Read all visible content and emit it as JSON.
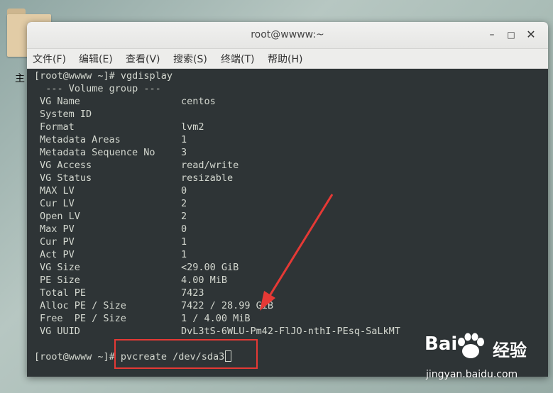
{
  "desktop": {
    "side_text": "主"
  },
  "window": {
    "title": "root@wwww:~",
    "min_glyph": "–",
    "max_glyph": "□",
    "close_glyph": "✕"
  },
  "menu": [
    "文件(F)",
    "编辑(E)",
    "查看(V)",
    "搜索(S)",
    "终端(T)",
    "帮助(H)"
  ],
  "terminal": {
    "prompt1": "[root@wwww ~]# vgdisplay",
    "header": "  --- Volume group ---",
    "rows": [
      {
        "key": "VG Name",
        "value": "centos"
      },
      {
        "key": "System ID",
        "value": ""
      },
      {
        "key": "Format",
        "value": "lvm2"
      },
      {
        "key": "Metadata Areas",
        "value": "1"
      },
      {
        "key": "Metadata Sequence No",
        "value": "3"
      },
      {
        "key": "VG Access",
        "value": "read/write"
      },
      {
        "key": "VG Status",
        "value": "resizable"
      },
      {
        "key": "MAX LV",
        "value": "0"
      },
      {
        "key": "Cur LV",
        "value": "2"
      },
      {
        "key": "Open LV",
        "value": "2"
      },
      {
        "key": "Max PV",
        "value": "0"
      },
      {
        "key": "Cur PV",
        "value": "1"
      },
      {
        "key": "Act PV",
        "value": "1"
      },
      {
        "key": "VG Size",
        "value": "<29.00 GiB"
      },
      {
        "key": "PE Size",
        "value": "4.00 MiB"
      },
      {
        "key": "Total PE",
        "value": "7423"
      },
      {
        "key": "Alloc PE / Size",
        "value": "7422 / 28.99 GiB"
      },
      {
        "key": "Free  PE / Size",
        "value": "1 / 4.00 MiB"
      },
      {
        "key": "VG UUID",
        "value": "DvL3tS-6WLU-Pm42-FlJO-nthI-PEsq-SaLkMT"
      }
    ],
    "prompt2": "[root@wwww ~]# ",
    "command2": "pvcreate /dev/sda3"
  },
  "annotation": {
    "highlight_color": "#e53935"
  },
  "watermark": {
    "logo": "Bai",
    "logo_cn": "经验",
    "url": "jingyan.baidu.com"
  }
}
